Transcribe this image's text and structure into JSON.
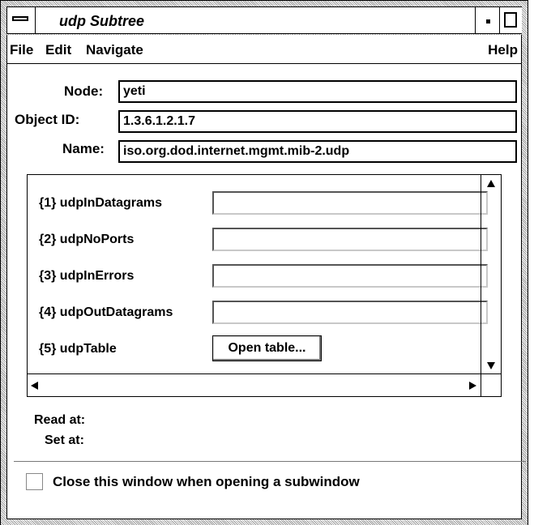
{
  "window": {
    "title": "udp Subtree"
  },
  "menubar": {
    "items": [
      "File",
      "Edit",
      "Navigate"
    ],
    "help": "Help"
  },
  "form": {
    "node_label": "Node:",
    "node_value": "yeti",
    "object_id_label": "Object ID:",
    "object_id_value": "1.3.6.1.2.1.7",
    "name_label": "Name:",
    "name_value": "iso.org.dod.internet.mgmt.mib-2.udp"
  },
  "objects": [
    {
      "label": "{1}  udpInDatagrams",
      "value": ""
    },
    {
      "label": "{2}  udpNoPorts",
      "value": ""
    },
    {
      "label": "{3}  udpInErrors",
      "value": ""
    },
    {
      "label": "{4}  udpOutDatagrams",
      "value": ""
    },
    {
      "label": "{5}  udpTable",
      "button": "Open table..."
    }
  ],
  "status": {
    "read_at_label": "Read at:",
    "set_at_label": "Set at:"
  },
  "options": {
    "close_on_subwindow_label": "Close this window when opening a subwindow",
    "close_on_subwindow_checked": false
  }
}
